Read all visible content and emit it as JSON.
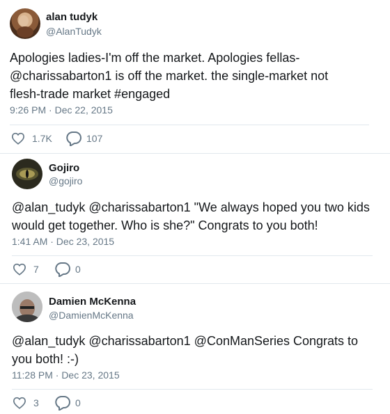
{
  "tweets": [
    {
      "name": "alan tudyk",
      "handle": "@AlanTudyk",
      "text": "Apologies ladies-I'm off the market. Apologies fellas-@charissabarton1 is off the market. the single-market not flesh-trade market #engaged",
      "time": "9:26 PM · Dec 22, 2015",
      "likes": "1.7K",
      "replies": "107"
    },
    {
      "name": "Gojiro",
      "handle": "@gojiro",
      "text": "@alan_tudyk @charissabarton1 \"We always hoped you two kids would get together. Who is she?\" Congrats to you both!",
      "time": "1:41 AM · Dec 23, 2015",
      "likes": "7",
      "replies": "0"
    },
    {
      "name": "Damien McKenna",
      "handle": "@DamienMcKenna",
      "text": "@alan_tudyk @charissabarton1 @ConManSeries Congrats to you both! :-)",
      "time": "11:28 PM · Dec 23, 2015",
      "likes": "3",
      "replies": "0"
    }
  ],
  "icons": {
    "like": "heart-outline-icon",
    "reply": "speech-bubble-icon"
  },
  "colors": {
    "text": "#14171a",
    "secondary": "#657786",
    "divider": "#e1e8ed"
  }
}
